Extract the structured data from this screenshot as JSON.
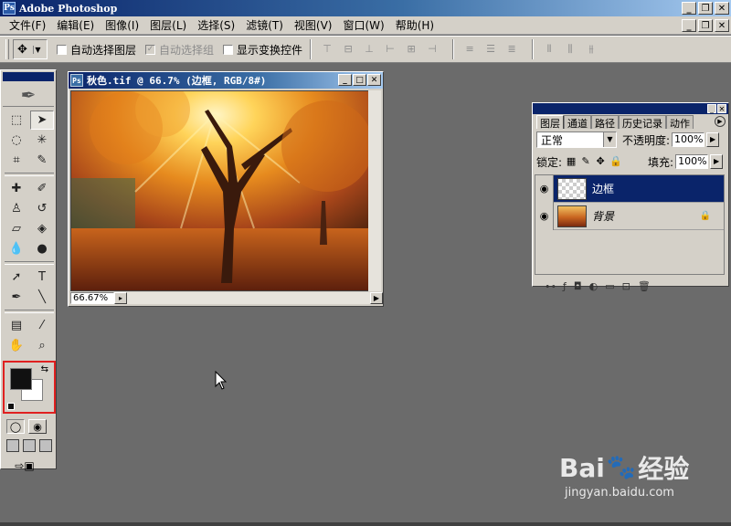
{
  "app": {
    "title": "Adobe Photoshop",
    "icon": "Ps"
  },
  "window_controls": {
    "minimize": "_",
    "restore": "❐",
    "close": "✕"
  },
  "menu": [
    "文件(F)",
    "编辑(E)",
    "图像(I)",
    "图层(L)",
    "选择(S)",
    "滤镜(T)",
    "视图(V)",
    "窗口(W)",
    "帮助(H)"
  ],
  "options": {
    "auto_select_layer": "自动选择图层",
    "auto_select_group": "自动选择组",
    "show_transform_controls": "显示变换控件"
  },
  "document": {
    "title": "秋色.tif @ 66.7% (边框, RGB/8#)",
    "zoom": "66.67%"
  },
  "layers_panel": {
    "tabs": [
      "图层",
      "通道",
      "路径",
      "历史记录",
      "动作"
    ],
    "blend_mode": "正常",
    "opacity_label": "不透明度:",
    "opacity": "100%",
    "lock_label": "锁定:",
    "fill_label": "填充:",
    "fill": "100%",
    "layers": [
      {
        "name": "边框",
        "selected": true
      },
      {
        "name": "背景",
        "selected": false,
        "locked": true
      }
    ]
  },
  "colors": {
    "foreground": "#111111",
    "background": "#ffffff",
    "highlight_box": "#e02020"
  },
  "watermark": {
    "brand": "Bai",
    "brand_suffix": "经验",
    "url": "jingyan.baidu.com"
  }
}
